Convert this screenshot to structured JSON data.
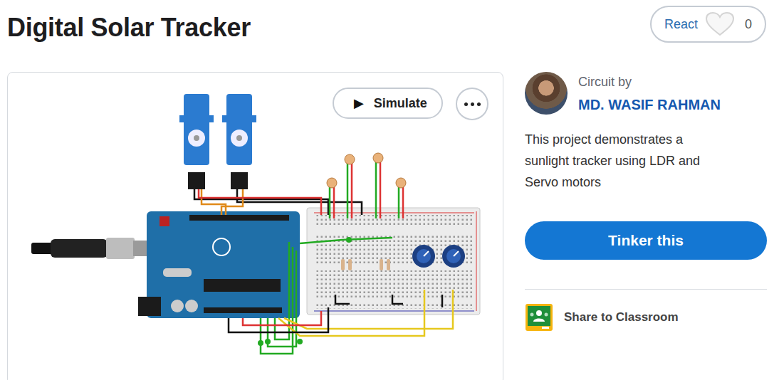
{
  "page": {
    "title": "Digital Solar Tracker"
  },
  "react": {
    "label": "React",
    "count": "0"
  },
  "simulate": {
    "icon": "▶",
    "label": "Simulate"
  },
  "author": {
    "caption": "Circuit by",
    "name": "MD. WASIF RAHMAN"
  },
  "description": [
    "This project demonstrates a",
    "sunlight tracker using LDR and",
    "Servo motors"
  ],
  "actions": {
    "primary": "Tinker this",
    "share": "Share to Classroom"
  }
}
